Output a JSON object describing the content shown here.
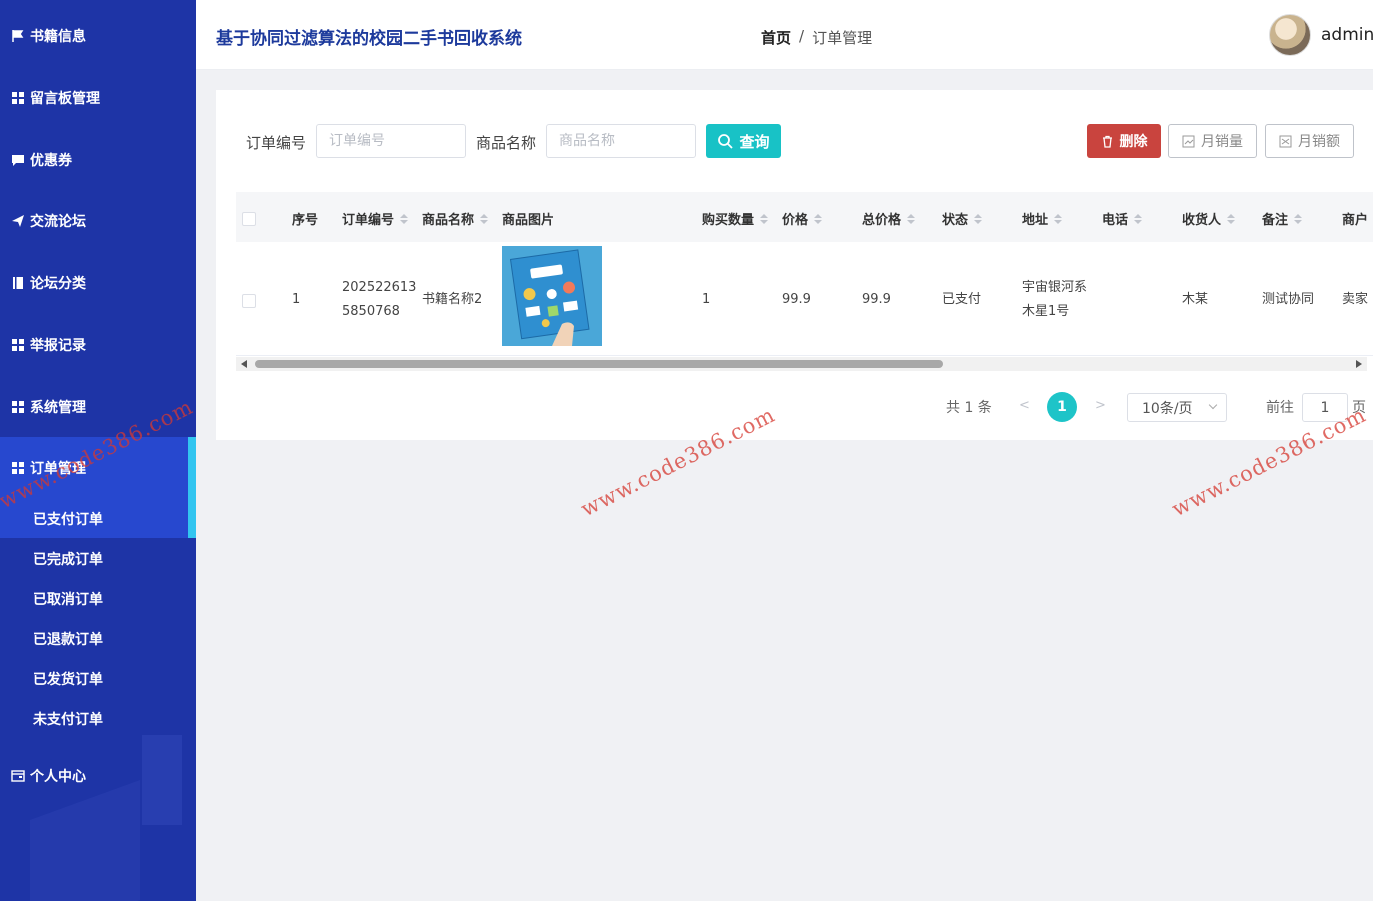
{
  "app": {
    "title": "基于协同过滤算法的校园二手书回收系统"
  },
  "breadcrumb": {
    "home": "首页",
    "separator": "/",
    "current": "订单管理"
  },
  "user": {
    "name": "admin"
  },
  "sidebar": {
    "items": [
      {
        "label": "书籍信息",
        "icon": "flag-icon"
      },
      {
        "label": "留言板管理",
        "icon": "grid-icon"
      },
      {
        "label": "优惠券",
        "icon": "chat-icon"
      },
      {
        "label": "交流论坛",
        "icon": "send-icon"
      },
      {
        "label": "论坛分类",
        "icon": "book-icon"
      },
      {
        "label": "举报记录",
        "icon": "grid-icon"
      },
      {
        "label": "系统管理",
        "icon": "grid-icon"
      },
      {
        "label": "订单管理",
        "icon": "grid-icon"
      },
      {
        "label": "个人中心",
        "icon": "wallet-icon"
      }
    ],
    "sub_items": [
      "已支付订单",
      "已完成订单",
      "已取消订单",
      "已退款订单",
      "已发货订单",
      "未支付订单"
    ]
  },
  "search": {
    "order_no_label": "订单编号",
    "order_no_placeholder": "订单编号",
    "product_label": "商品名称",
    "product_placeholder": "商品名称",
    "query_button": "查询"
  },
  "actions": {
    "delete": "删除",
    "monthly_sales_qty": "月销量",
    "monthly_sales_amount": "月销额"
  },
  "table": {
    "headers": [
      "序号",
      "订单编号",
      "商品名称",
      "商品图片",
      "购买数量",
      "价格",
      "总价格",
      "状态",
      "地址",
      "电话",
      "收货人",
      "备注",
      "商户"
    ],
    "rows": [
      {
        "index": "1",
        "order_no_line1": "202522613",
        "order_no_line2": "5850768",
        "product": "书籍名称2",
        "quantity": "1",
        "price": "99.9",
        "total": "99.9",
        "status": "已支付",
        "address_line1": "宇宙银河系",
        "address_line2": "木星1号",
        "phone": "",
        "receiver": "木某",
        "remark": "测试协同",
        "merchant": "卖家"
      }
    ]
  },
  "pagination": {
    "total": "共 1 条",
    "prev": "<",
    "current": "1",
    "next": ">",
    "page_size": "10条/页",
    "goto": "前往",
    "goto_value": "1",
    "page_unit": "页"
  },
  "watermark": "www.code386.com",
  "colors": {
    "sidebar": "#1e34a6",
    "accent": "#18c2c6",
    "danger": "#c9443e",
    "active_bar": "#32c5f0",
    "title": "#1d3a9c"
  }
}
